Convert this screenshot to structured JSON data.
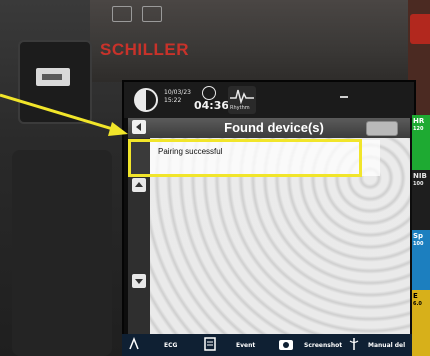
{
  "device": {
    "brand": "SCHILLER"
  },
  "statusbar": {
    "date": "10/03/23",
    "clock": "15:22",
    "timer": "04:36",
    "rhythm_label": "Rhythm",
    "separator": "–"
  },
  "vitals": {
    "hr": {
      "label": "HR",
      "value": "120",
      "color": "#1eaa32"
    },
    "nib": {
      "label": "NIB",
      "value": "100",
      "color": "#1e1e1e"
    },
    "spo2": {
      "label": "Sp",
      "value": "100",
      "color": "#1c7fbf"
    },
    "etco2": {
      "label": "E",
      "value": "6.0",
      "color": "#d7b01a"
    }
  },
  "dialog": {
    "title": "Found device(s)",
    "items": [
      {
        "label": "Pairing successful"
      }
    ]
  },
  "bottom_bar": {
    "ecg": "ECG",
    "event": "Event",
    "screenshot": "Screenshot",
    "manual": "Manual del"
  },
  "annotation": {
    "color": "#f1e52a"
  }
}
